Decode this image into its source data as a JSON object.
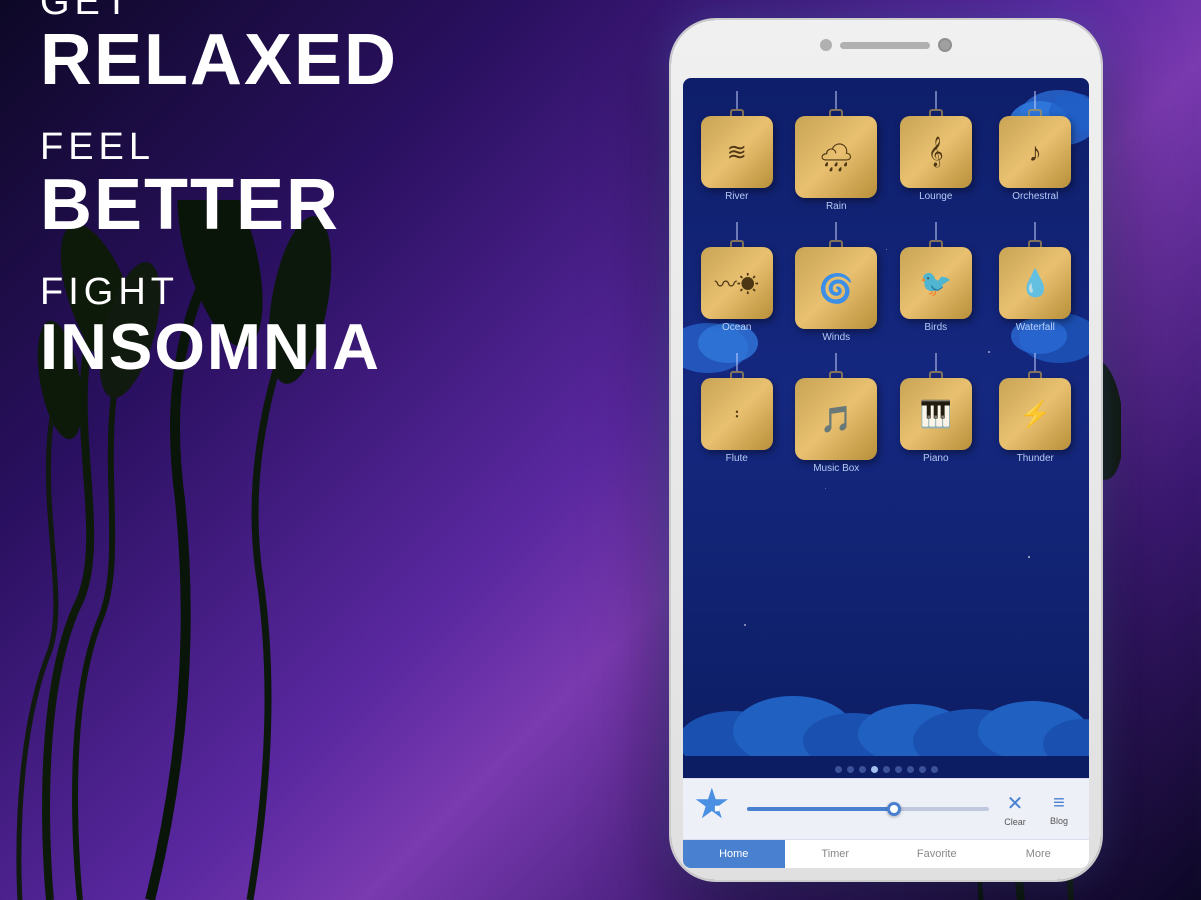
{
  "background": {
    "gradient_start": "#1a0a3a",
    "gradient_end": "#6b2fa0"
  },
  "left_text": {
    "line1": "GET",
    "line2": "RELAXED",
    "line3": "FEEL",
    "line4": "BETTER",
    "line5": "FIGHT",
    "line6": "INSOMNIA"
  },
  "phone": {
    "screen": {
      "sounds": [
        {
          "id": "river",
          "label": "River",
          "symbol": "≋",
          "col": 0,
          "row": 0
        },
        {
          "id": "rain",
          "label": "Rain",
          "symbol": "🌧",
          "col": 1,
          "row": 0
        },
        {
          "id": "lounge",
          "label": "Lounge",
          "symbol": "𝄞",
          "col": 2,
          "row": 0
        },
        {
          "id": "orchestral",
          "label": "Orchestral",
          "symbol": "♪",
          "col": 3,
          "row": 0
        },
        {
          "id": "ocean",
          "label": "Ocean",
          "symbol": "〰",
          "col": 0,
          "row": 1
        },
        {
          "id": "winds",
          "label": "Winds",
          "symbol": "🌀",
          "col": 1,
          "row": 1
        },
        {
          "id": "birds",
          "label": "Birds",
          "symbol": "🐦",
          "col": 2,
          "row": 1
        },
        {
          "id": "waterfall",
          "label": "Waterfall",
          "symbol": "💧",
          "col": 3,
          "row": 1
        },
        {
          "id": "flute",
          "label": "Flute",
          "symbol": "|||",
          "col": 0,
          "row": 2
        },
        {
          "id": "music-box",
          "label": "Music Box",
          "symbol": "🎵",
          "col": 1,
          "row": 2
        },
        {
          "id": "piano",
          "label": "Piano",
          "symbol": "🎹",
          "col": 2,
          "row": 2
        },
        {
          "id": "thunder",
          "label": "Thunder",
          "symbol": "⚡",
          "col": 3,
          "row": 2
        }
      ],
      "page_dots": 9,
      "active_dot": 3
    },
    "bottom_bar": {
      "clear_label": "Clear",
      "blog_label": "Blog",
      "progress_percent": 60
    },
    "nav_tabs": [
      {
        "id": "home",
        "label": "Home",
        "active": true
      },
      {
        "id": "timer",
        "label": "Timer",
        "active": false
      },
      {
        "id": "favorite",
        "label": "Favorite",
        "active": false
      },
      {
        "id": "more",
        "label": "More",
        "active": false
      }
    ]
  }
}
